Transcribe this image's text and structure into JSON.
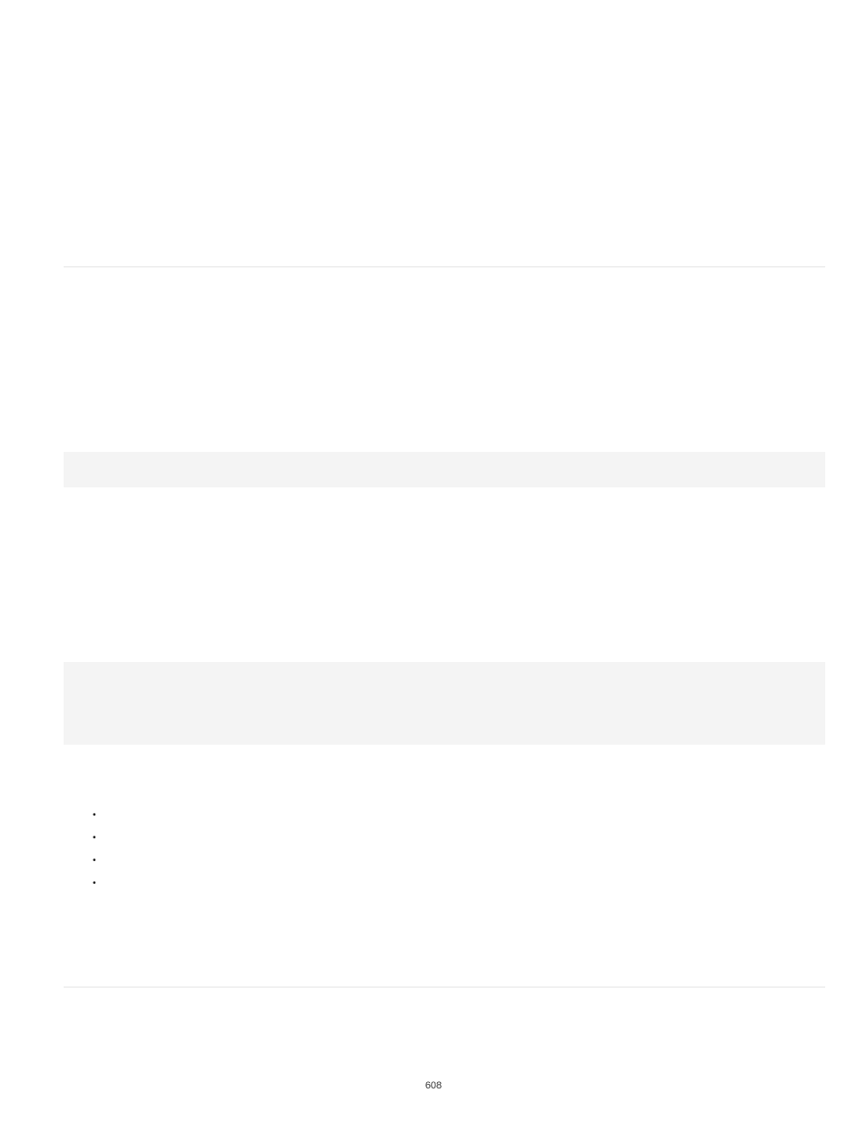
{
  "page_number": "608",
  "bullets": [
    "",
    "",
    "",
    ""
  ]
}
